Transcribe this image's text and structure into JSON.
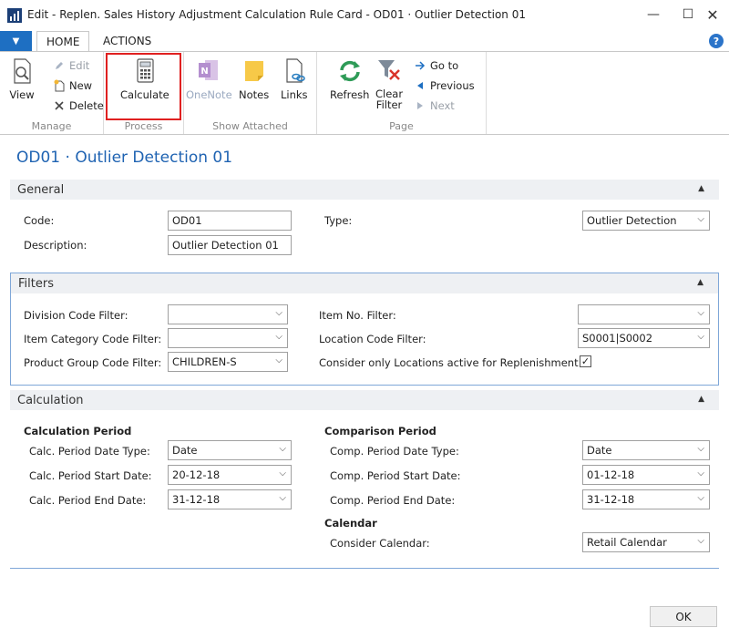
{
  "window": {
    "title": "Edit - Replen. Sales History Adjustment Calculation Rule Card - OD01 · Outlier Detection 01",
    "min_glyph": "—",
    "max_glyph": "☐",
    "close_glyph": "✕"
  },
  "ribbon_tabs": {
    "home": "HOME",
    "actions": "ACTIONS",
    "dropdown_glyph": "▼",
    "help_glyph": "?"
  },
  "ribbon": {
    "manage": {
      "label": "Manage",
      "view": "View",
      "edit": "Edit",
      "new": "New",
      "delete": "Delete"
    },
    "process": {
      "label": "Process",
      "calculate": "Calculate"
    },
    "show_attached": {
      "label": "Show Attached",
      "onenote": "OneNote",
      "notes": "Notes",
      "links": "Links"
    },
    "page": {
      "label": "Page",
      "refresh": "Refresh",
      "clear_filter_1": "Clear",
      "clear_filter_2": "Filter",
      "goto": "Go to",
      "previous": "Previous",
      "next": "Next"
    }
  },
  "page_title": "OD01 · Outlier Detection 01",
  "general": {
    "header": "General",
    "code_label": "Code:",
    "code_value": "OD01",
    "description_label": "Description:",
    "description_value": "Outlier Detection 01",
    "type_label": "Type:",
    "type_value": "Outlier Detection"
  },
  "filters": {
    "header": "Filters",
    "division_label": "Division Code Filter:",
    "division_value": "",
    "item_category_label": "Item Category Code Filter:",
    "item_category_value": "",
    "product_group_label": "Product Group Code Filter:",
    "product_group_value": "CHILDREN-S",
    "item_no_label": "Item No. Filter:",
    "item_no_value": "",
    "location_label": "Location Code Filter:",
    "location_value": "S0001|S0002",
    "consider_locations_label": "Consider only Locations active for Replenishment:",
    "consider_locations_checked": "✓"
  },
  "calculation": {
    "header": "Calculation",
    "calc_period_header": "Calculation Period",
    "calc_date_type_label": "Calc. Period Date Type:",
    "calc_date_type_value": "Date",
    "calc_start_label": "Calc. Period Start Date:",
    "calc_start_value": "20-12-18",
    "calc_end_label": "Calc. Period End Date:",
    "calc_end_value": "31-12-18",
    "comp_period_header": "Comparison Period",
    "comp_date_type_label": "Comp. Period Date Type:",
    "comp_date_type_value": "Date",
    "comp_start_label": "Comp. Period Start Date:",
    "comp_start_value": "01-12-18",
    "comp_end_label": "Comp. Period End Date:",
    "comp_end_value": "31-12-18",
    "calendar_header": "Calendar",
    "consider_calendar_label": "Consider Calendar:",
    "consider_calendar_value": "Retail Calendar"
  },
  "footer": {
    "ok": "OK"
  },
  "glyphs": {
    "dropdown": "⌵",
    "collapse": "▲"
  },
  "colors": {
    "accent_blue": "#1e6fc2",
    "title_blue": "#1f63b2",
    "highlight_red": "#e02020",
    "refresh_green": "#2e9b57",
    "clear_red": "#d9342b"
  }
}
